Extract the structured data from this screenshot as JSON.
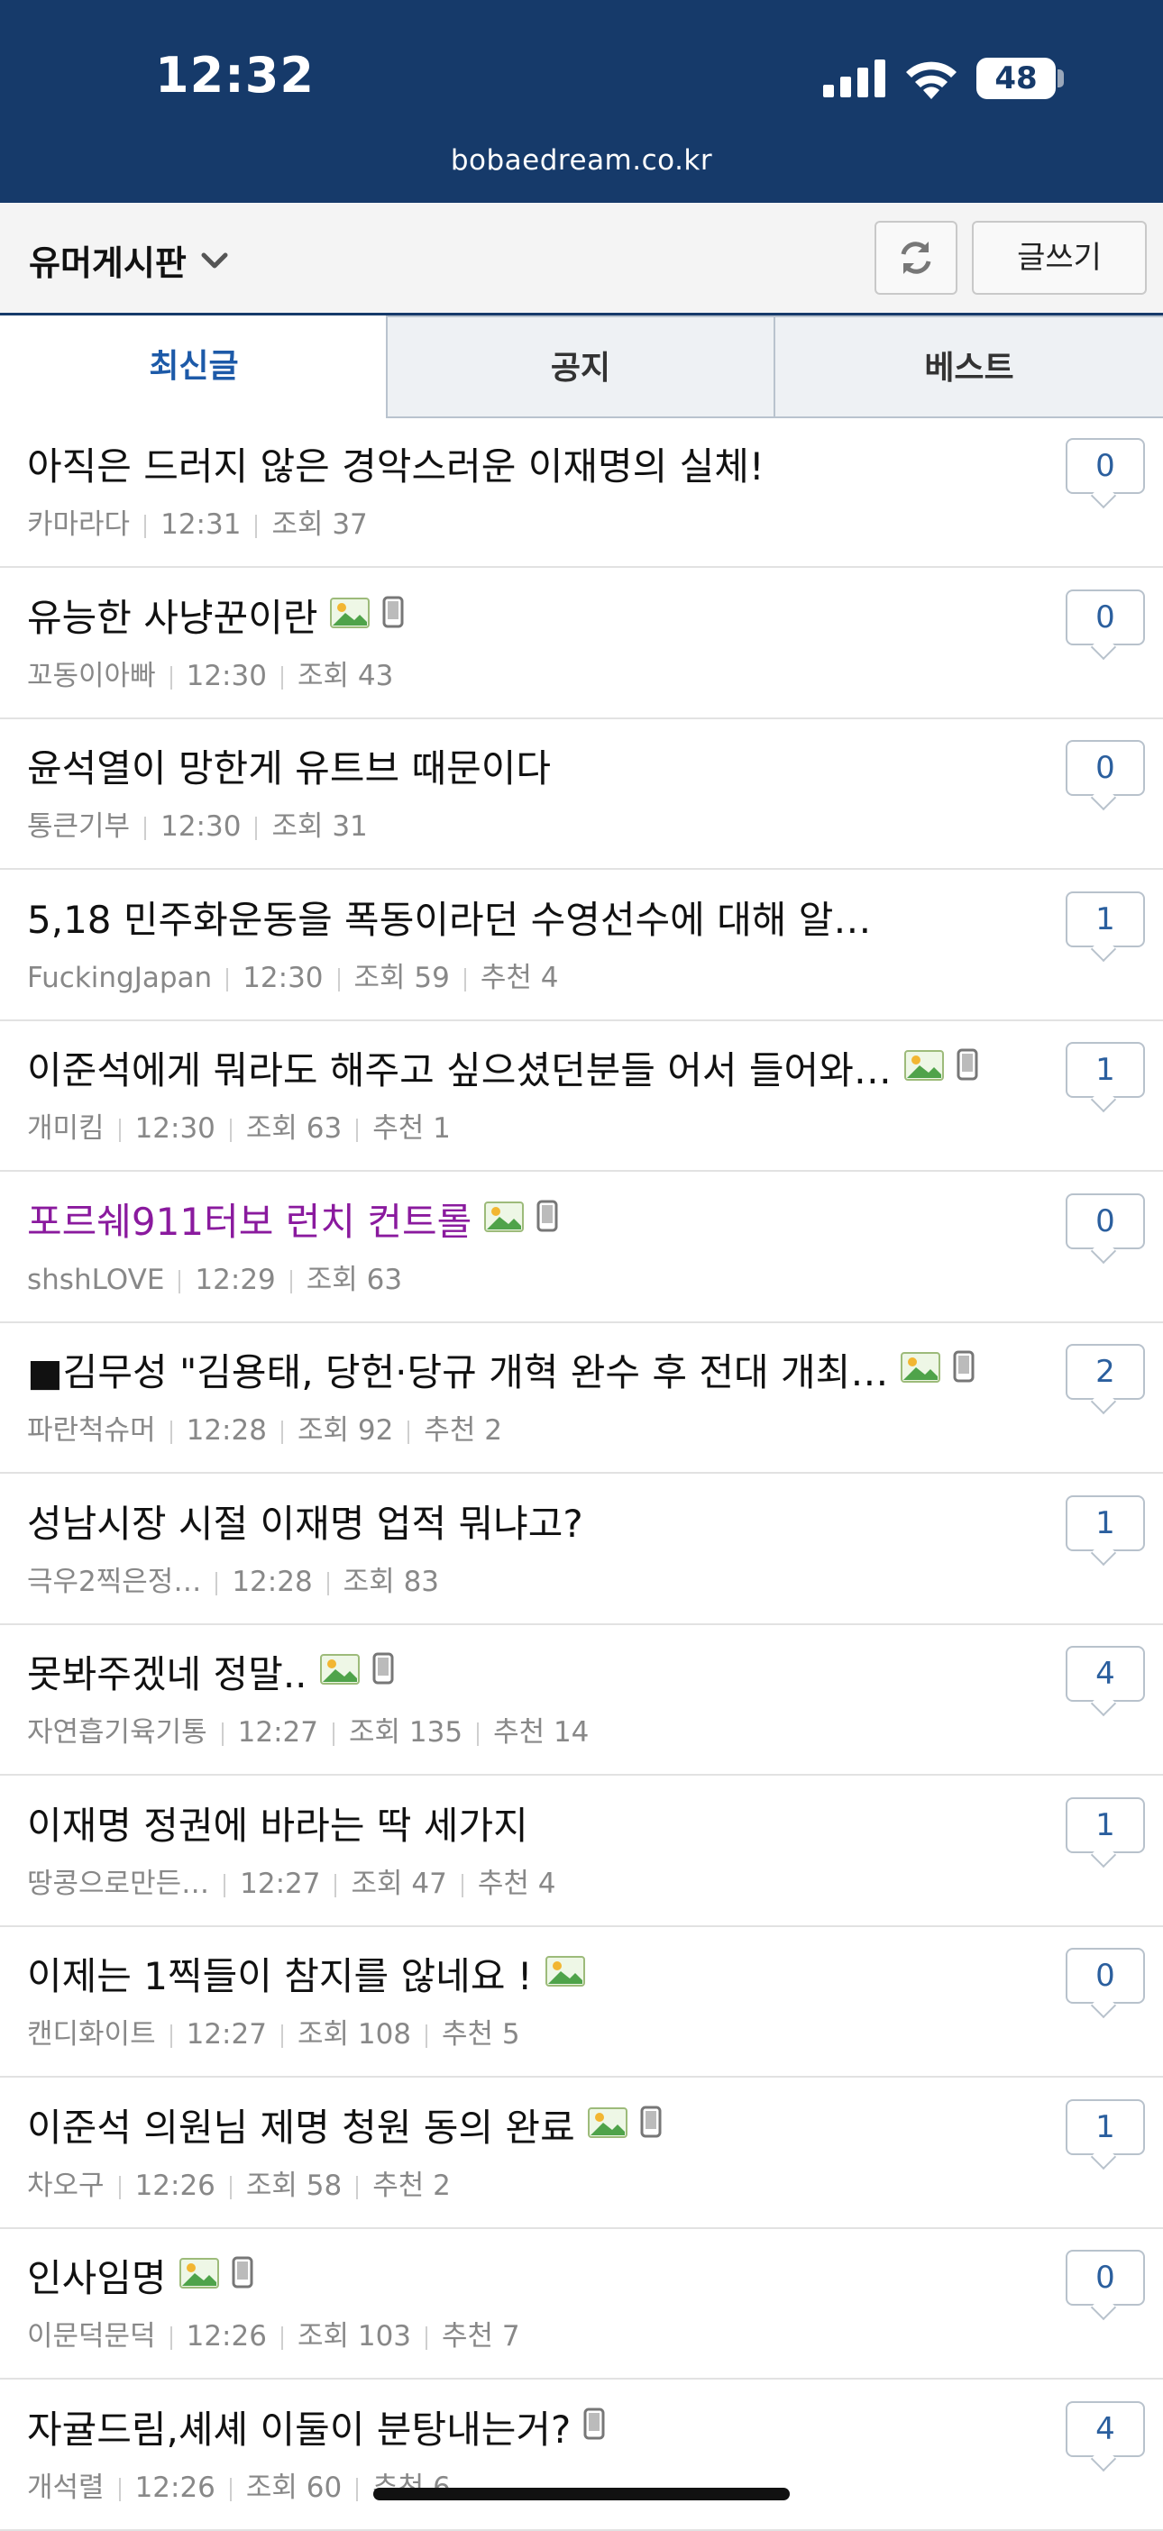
{
  "status_bar": {
    "time": "12:32",
    "battery": "48",
    "url": "bobaedream.co.kr"
  },
  "board": {
    "title": "유머게시판",
    "write_label": "글쓰기"
  },
  "tabs": [
    {
      "label": "최신글",
      "active": true
    },
    {
      "label": "공지",
      "active": false
    },
    {
      "label": "베스트",
      "active": false
    }
  ],
  "posts": [
    {
      "title": "아직은 드러지 않은 경악스러운 이재명의 실체!",
      "author": "카마라다",
      "time": "12:31",
      "views": "조회 37",
      "rec": "",
      "comments": "0",
      "image": false,
      "mobile": false
    },
    {
      "title": "유능한 사냥꾼이란",
      "author": "꼬동이아빠",
      "time": "12:30",
      "views": "조회 43",
      "rec": "",
      "comments": "0",
      "image": true,
      "mobile": true
    },
    {
      "title": "윤석열이 망한게 유트브 때문이다",
      "author": "통큰기부",
      "time": "12:30",
      "views": "조회 31",
      "rec": "",
      "comments": "0",
      "image": false,
      "mobile": false
    },
    {
      "title": "5,18 민주화운동을 폭동이라던 수영선수에 대해 알…",
      "author": "FuckingJapan",
      "time": "12:30",
      "views": "조회 59",
      "rec": "추천 4",
      "comments": "1",
      "image": false,
      "mobile": false
    },
    {
      "title": "이준석에게 뭐라도 해주고 싶으셨던분들 어서 들어와…",
      "author": "개미킴",
      "time": "12:30",
      "views": "조회 63",
      "rec": "추천 1",
      "comments": "1",
      "image": true,
      "mobile": true
    },
    {
      "title": "포르쉐911터보 런치 컨트롤",
      "author": "shshLOVE",
      "time": "12:29",
      "views": "조회 63",
      "rec": "",
      "comments": "0",
      "image": true,
      "mobile": true,
      "purple": true
    },
    {
      "title": "■김무성 \"김용태, 당헌·당규 개혁 완수 후 전대 개최…",
      "author": "파란척슈머",
      "time": "12:28",
      "views": "조회 92",
      "rec": "추천 2",
      "comments": "2",
      "image": true,
      "mobile": true
    },
    {
      "title": "성남시장 시절 이재명 업적 뭐냐고?",
      "author": "극우2찍은정…",
      "time": "12:28",
      "views": "조회 83",
      "rec": "",
      "comments": "1",
      "image": false,
      "mobile": false
    },
    {
      "title": "못봐주겠네 정말..",
      "author": "자연흡기육기통",
      "time": "12:27",
      "views": "조회 135",
      "rec": "추천 14",
      "comments": "4",
      "image": true,
      "mobile": true
    },
    {
      "title": "이재명 정권에 바라는 딱 세가지",
      "author": "땅콩으로만든…",
      "time": "12:27",
      "views": "조회 47",
      "rec": "추천 4",
      "comments": "1",
      "image": false,
      "mobile": false
    },
    {
      "title": "이제는 1찍들이 참지를 않네요 !",
      "author": "캔디화이트",
      "time": "12:27",
      "views": "조회 108",
      "rec": "추천 5",
      "comments": "0",
      "image": true,
      "mobile": false
    },
    {
      "title": "이준석 의원님 제명 청원 동의 완료",
      "author": "차오구",
      "time": "12:26",
      "views": "조회 58",
      "rec": "추천 2",
      "comments": "1",
      "image": true,
      "mobile": true
    },
    {
      "title": "인사임명",
      "author": "이문덕문덕",
      "time": "12:26",
      "views": "조회 103",
      "rec": "추천 7",
      "comments": "0",
      "image": true,
      "mobile": true
    },
    {
      "title": "자귤드림,셰셰 이둘이 분탕내는거?",
      "author": "개석렬",
      "time": "12:26",
      "views": "조회 60",
      "rec": "추천 6",
      "comments": "4",
      "image": false,
      "mobile": true
    }
  ]
}
